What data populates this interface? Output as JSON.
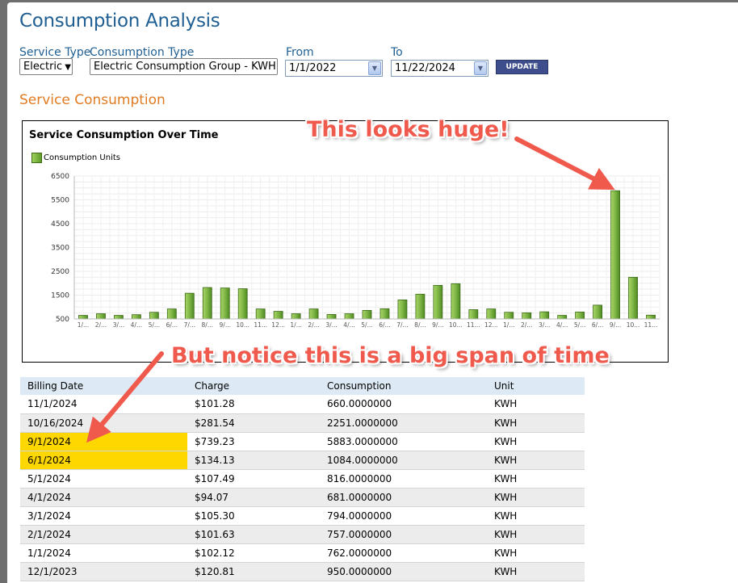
{
  "header": {
    "title": "Consumption Analysis"
  },
  "filters": {
    "service_type_label": "Service Type",
    "service_type_value": "Electric",
    "consumption_type_label": "Consumption Type",
    "consumption_type_value": "Electric Consumption Group - KWH",
    "from_label": "From",
    "from_value": "1/1/2022",
    "to_label": "To",
    "to_value": "11/22/2024",
    "update_label": "UPDATE"
  },
  "section_title": "Service Consumption",
  "chart_data": {
    "type": "bar",
    "title": "Service Consumption Over Time",
    "legend": "Consumption Units",
    "legend_position": "top-left",
    "grid": true,
    "ylim": [
      500,
      6500
    ],
    "yticks": [
      "6500",
      "5500",
      "4500",
      "3500",
      "2500",
      "1500",
      "500"
    ],
    "ytick_values": [
      6500,
      5500,
      4500,
      3500,
      2500,
      1500,
      500
    ],
    "categories": [
      "1/...",
      "2/...",
      "3/...",
      "4/...",
      "5/...",
      "6/...",
      "7/...",
      "8/...",
      "9/...",
      "10...",
      "11...",
      "12...",
      "1/...",
      "2/...",
      "3/...",
      "4/...",
      "5/...",
      "6/...",
      "7/...",
      "8/...",
      "9/...",
      "10...",
      "11...",
      "12...",
      "1/...",
      "2/...",
      "3/...",
      "4/...",
      "5/...",
      "6/...",
      "9/...",
      "10...",
      "11..."
    ],
    "values": [
      650,
      720,
      650,
      680,
      780,
      920,
      1580,
      1820,
      1800,
      1770,
      920,
      820,
      720,
      920,
      690,
      720,
      860,
      930,
      1300,
      1540,
      1910,
      1980,
      890,
      920,
      780,
      760,
      800,
      650,
      790,
      1080,
      5883,
      2251,
      660
    ],
    "bar_color": "#6fa83a"
  },
  "table": {
    "headers": [
      "Billing Date",
      "Charge",
      "Consumption",
      "Unit"
    ],
    "rows": [
      [
        "11/1/2024",
        "$101.28",
        "660.0000000",
        "KWH"
      ],
      [
        "10/16/2024",
        "$281.54",
        "2251.0000000",
        "KWH"
      ],
      [
        "9/1/2024",
        "$739.23",
        "5883.0000000",
        "KWH"
      ],
      [
        "6/1/2024",
        "$134.13",
        "1084.0000000",
        "KWH"
      ],
      [
        "5/1/2024",
        "$107.49",
        "816.0000000",
        "KWH"
      ],
      [
        "4/1/2024",
        "$94.07",
        "681.0000000",
        "KWH"
      ],
      [
        "3/1/2024",
        "$105.30",
        "794.0000000",
        "KWH"
      ],
      [
        "2/1/2024",
        "$101.63",
        "757.0000000",
        "KWH"
      ],
      [
        "1/1/2024",
        "$102.12",
        "762.0000000",
        "KWH"
      ],
      [
        "12/1/2023",
        "$120.81",
        "950.0000000",
        "KWH"
      ]
    ],
    "highlighted_rows": [
      2,
      3
    ],
    "highlight_color": "#ffd700"
  },
  "annotations": {
    "top_text": "This looks huge!",
    "bottom_text": "But notice this is a big span of time",
    "color": "#ef5a4d"
  }
}
